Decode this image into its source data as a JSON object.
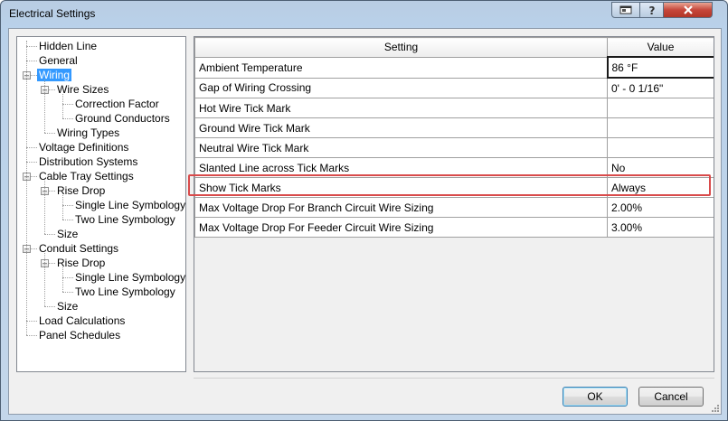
{
  "window": {
    "title": "Electrical Settings"
  },
  "tree": {
    "items": [
      {
        "label": "Hidden Line",
        "level": 0,
        "expander": "",
        "selected": false
      },
      {
        "label": "General",
        "level": 0,
        "expander": "",
        "selected": false
      },
      {
        "label": "Wiring",
        "level": 0,
        "expander": "minus",
        "selected": true
      },
      {
        "label": "Wire Sizes",
        "level": 1,
        "expander": "minus",
        "selected": false
      },
      {
        "label": "Correction Factor",
        "level": 2,
        "expander": "",
        "selected": false
      },
      {
        "label": "Ground Conductors",
        "level": 2,
        "expander": "",
        "selected": false
      },
      {
        "label": "Wiring Types",
        "level": 1,
        "expander": "",
        "selected": false
      },
      {
        "label": "Voltage Definitions",
        "level": 0,
        "expander": "",
        "selected": false
      },
      {
        "label": "Distribution Systems",
        "level": 0,
        "expander": "",
        "selected": false
      },
      {
        "label": "Cable Tray Settings",
        "level": 0,
        "expander": "minus",
        "selected": false
      },
      {
        "label": "Rise Drop",
        "level": 1,
        "expander": "minus",
        "selected": false
      },
      {
        "label": "Single Line Symbology",
        "level": 2,
        "expander": "",
        "selected": false
      },
      {
        "label": "Two Line Symbology",
        "level": 2,
        "expander": "",
        "selected": false
      },
      {
        "label": "Size",
        "level": 1,
        "expander": "",
        "selected": false
      },
      {
        "label": "Conduit Settings",
        "level": 0,
        "expander": "minus",
        "selected": false
      },
      {
        "label": "Rise Drop",
        "level": 1,
        "expander": "minus",
        "selected": false
      },
      {
        "label": "Single Line Symbology",
        "level": 2,
        "expander": "",
        "selected": false
      },
      {
        "label": "Two Line Symbology",
        "level": 2,
        "expander": "",
        "selected": false
      },
      {
        "label": "Size",
        "level": 1,
        "expander": "",
        "selected": false
      },
      {
        "label": "Load Calculations",
        "level": 0,
        "expander": "",
        "selected": false
      },
      {
        "label": "Panel Schedules",
        "level": 0,
        "expander": "",
        "selected": false
      }
    ]
  },
  "grid": {
    "headers": {
      "setting": "Setting",
      "value": "Value"
    },
    "rows": [
      {
        "setting": "Ambient Temperature",
        "value": "86 °F"
      },
      {
        "setting": "Gap of Wiring Crossing",
        "value": "0' - 0 1/16\""
      },
      {
        "setting": "Hot Wire Tick Mark",
        "value": ""
      },
      {
        "setting": "Ground Wire Tick Mark",
        "value": ""
      },
      {
        "setting": "Neutral Wire Tick Mark",
        "value": ""
      },
      {
        "setting": "Slanted Line across Tick Marks",
        "value": "No"
      },
      {
        "setting": "Show Tick Marks",
        "value": "Always"
      },
      {
        "setting": "Max Voltage Drop For Branch Circuit Wire Sizing",
        "value": "2.00%"
      },
      {
        "setting": "Max Voltage Drop For Feeder Circuit Wire Sizing",
        "value": "3.00%"
      }
    ],
    "highlighted_row": "Show Tick Marks"
  },
  "buttons": {
    "ok": "OK",
    "cancel": "Cancel"
  },
  "colors": {
    "highlight": "#d94b4b",
    "selection": "#3399ff",
    "close": "#c6463a"
  },
  "icons": {
    "restore": "restore-icon",
    "help": "help-icon",
    "close": "close-icon"
  }
}
